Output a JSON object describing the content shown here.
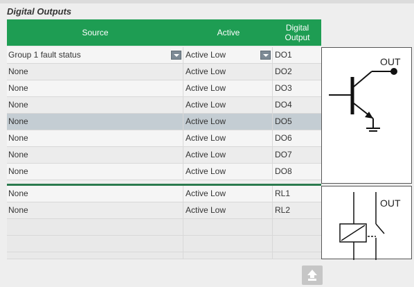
{
  "section": {
    "title": "Digital Outputs"
  },
  "table": {
    "headers": {
      "source": "Source",
      "active": "Active",
      "output_line1": "Digital",
      "output_line2": "Output"
    },
    "rows": [
      {
        "source": "Group 1 fault status",
        "active": "Active Low",
        "output": "DO1"
      },
      {
        "source": "None",
        "active": "Active Low",
        "output": "DO2"
      },
      {
        "source": "None",
        "active": "Active Low",
        "output": "DO3"
      },
      {
        "source": "None",
        "active": "Active Low",
        "output": "DO4"
      },
      {
        "source": "None",
        "active": "Active Low",
        "output": "DO5"
      },
      {
        "source": "None",
        "active": "Active Low",
        "output": "DO6"
      },
      {
        "source": "None",
        "active": "Active Low",
        "output": "DO7"
      },
      {
        "source": "None",
        "active": "Active Low",
        "output": "DO8"
      },
      {
        "source": "None",
        "active": "Active Low",
        "output": "RL1"
      },
      {
        "source": "None",
        "active": "Active Low",
        "output": "RL2"
      }
    ]
  },
  "diagrams": {
    "transistor_label": "OUT",
    "relay_label": "OUT"
  },
  "colors": {
    "header_bg": "#1e9d53",
    "divider": "#2b7a4e",
    "selected_row": "#c4cdd3"
  },
  "icons": {
    "dropdown": "chevron-down-icon",
    "upload": "upload-icon"
  }
}
